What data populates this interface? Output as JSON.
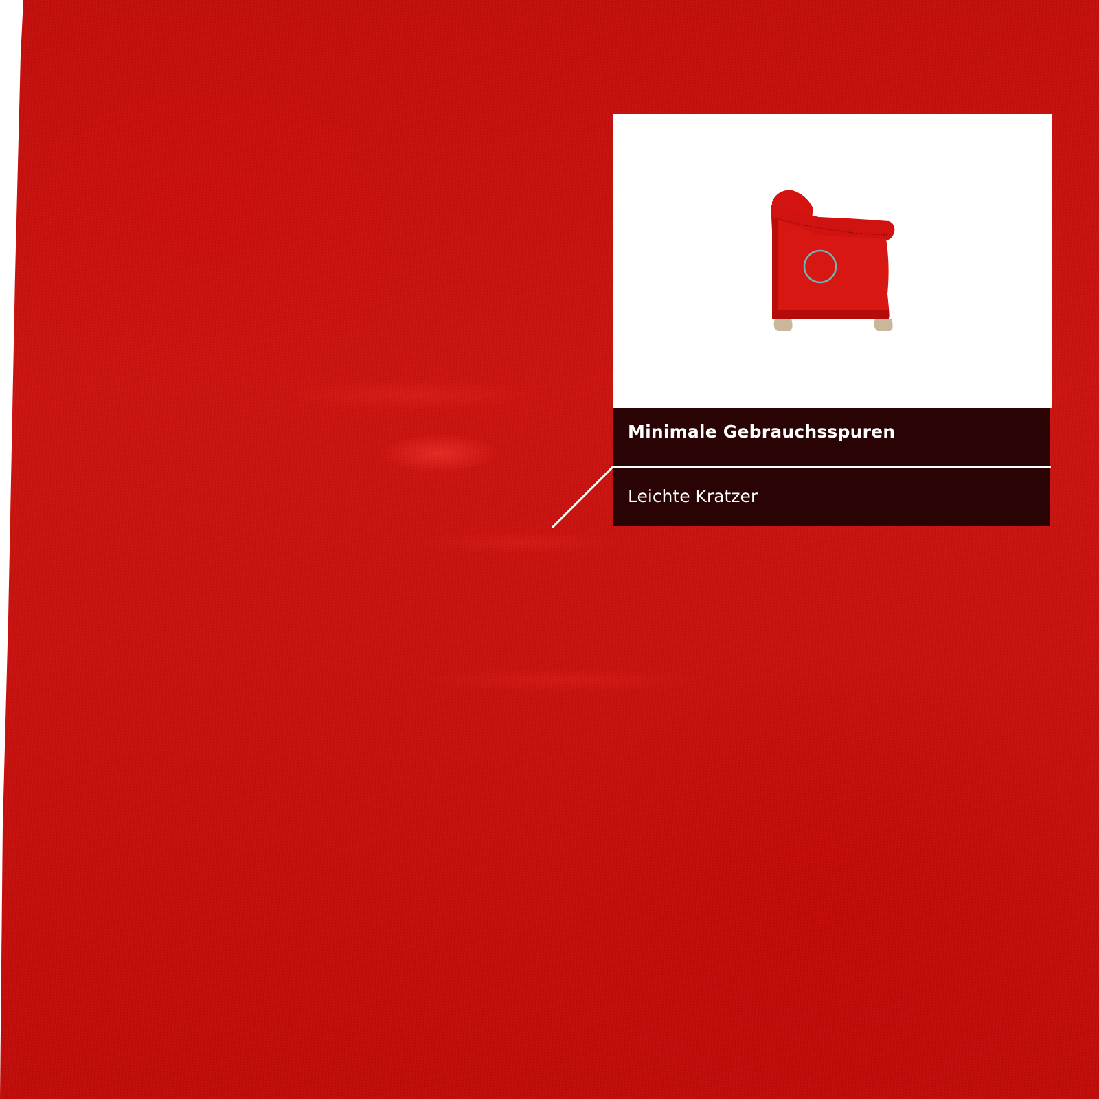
{
  "card": {
    "title": "Minimale Gebrauchsspuren",
    "detail": "Leichte Kratzer"
  },
  "thumbnail": {
    "subject": "sofa-side-view-icon",
    "marker": "highlight-circle-icon"
  },
  "colors": {
    "fabric": "#c8100c",
    "card_bar": "#2a0304",
    "card_text": "#ffffff",
    "marker": "#6fb5b8",
    "pointer": "#ffffff"
  }
}
